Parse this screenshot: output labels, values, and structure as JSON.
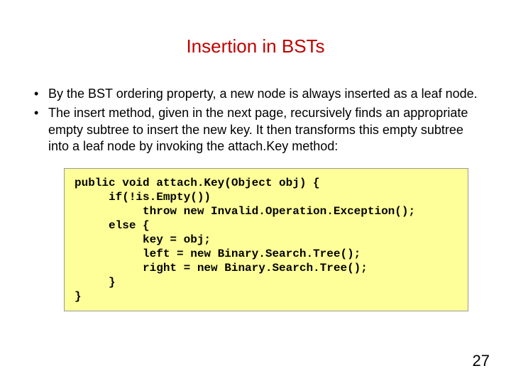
{
  "title": "Insertion in BSTs",
  "bullets": [
    "By the BST ordering property, a new node is always inserted as a leaf node.",
    "The insert method, given in the next page, recursively finds an appropriate empty subtree to insert the new key. It then transforms this empty subtree into a leaf node by invoking the attach.Key method:"
  ],
  "code": "public void attach.Key(Object obj) {\n     if(!is.Empty())\n          throw new Invalid.Operation.Exception();\n     else {\n          key = obj;\n          left = new Binary.Search.Tree();\n          right = new Binary.Search.Tree();\n     }\n}",
  "pageNumber": "27"
}
